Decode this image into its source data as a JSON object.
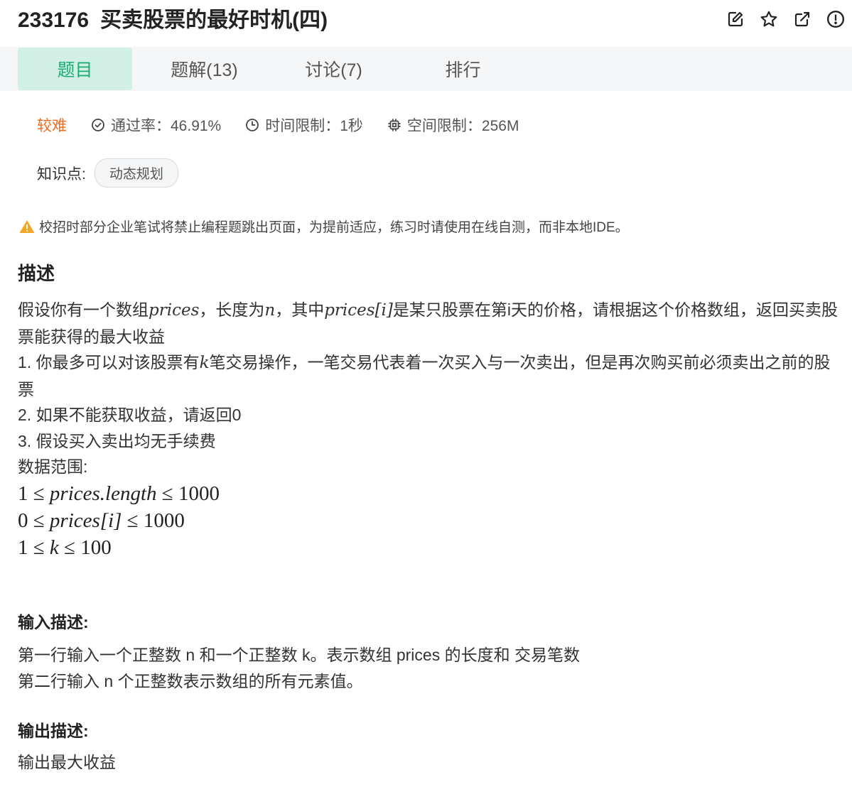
{
  "problem": {
    "id": "233176",
    "title": "买卖股票的最好时机(四)"
  },
  "header_icons": [
    "edit-icon",
    "star-icon",
    "share-icon",
    "report-icon"
  ],
  "tabs": [
    {
      "label": "题目",
      "active": true
    },
    {
      "label": "题解(13)",
      "active": false
    },
    {
      "label": "讨论(7)",
      "active": false
    },
    {
      "label": "排行",
      "active": false
    }
  ],
  "meta": {
    "difficulty": "较难",
    "pass_rate": "通过率：46.91%",
    "time_limit": "时间限制：1秒",
    "memory_limit": "空间限制：256M"
  },
  "knowledge": {
    "label": "知识点:",
    "tags": [
      "动态规划"
    ]
  },
  "warning": "校招时部分企业笔试将禁止编程题跳出页面，为提前适应，练习时请使用在线自测，而非本地IDE。",
  "description": {
    "heading": "描述",
    "p1_a": "假设你有一个数组",
    "p1_var1": "prices",
    "p1_b": "，长度为",
    "p1_var2": "n",
    "p1_c": "，其中",
    "p1_var3": "prices[i]",
    "p1_d": "是某只股票在第i天的价格，请根据这个价格数组，返回买卖股票能获得的最大收益",
    "p2_a": "1. 你最多可以对该股票有",
    "p2_var": "k",
    "p2_b": "笔交易操作，一笔交易代表着一次买入与一次卖出，但是再次购买前必须卖出之前的股票",
    "p3": "2. 如果不能获取收益，请返回0",
    "p4": "3. 假设买入卖出均无手续费",
    "range_label": "数据范围:",
    "ranges": [
      {
        "lo": "1",
        "expr": "prices.length",
        "hi": "1000"
      },
      {
        "lo": "0",
        "expr": "prices[i]",
        "hi": "1000"
      },
      {
        "lo": "1",
        "expr": "k",
        "hi": "100"
      }
    ]
  },
  "input": {
    "heading": "输入描述:",
    "line1": "第一行输入一个正整数 n 和一个正整数 k。表示数组 prices 的长度和 交易笔数",
    "line2": "第二行输入 n 个正整数表示数组的所有元素值。"
  },
  "output": {
    "heading": "输出描述:",
    "line1": "输出最大收益"
  },
  "colors": {
    "accent": "#1aad74",
    "tab_active_bg": "#d3f0e6",
    "difficulty": "#f36a1d",
    "warning": "#f5a623"
  }
}
